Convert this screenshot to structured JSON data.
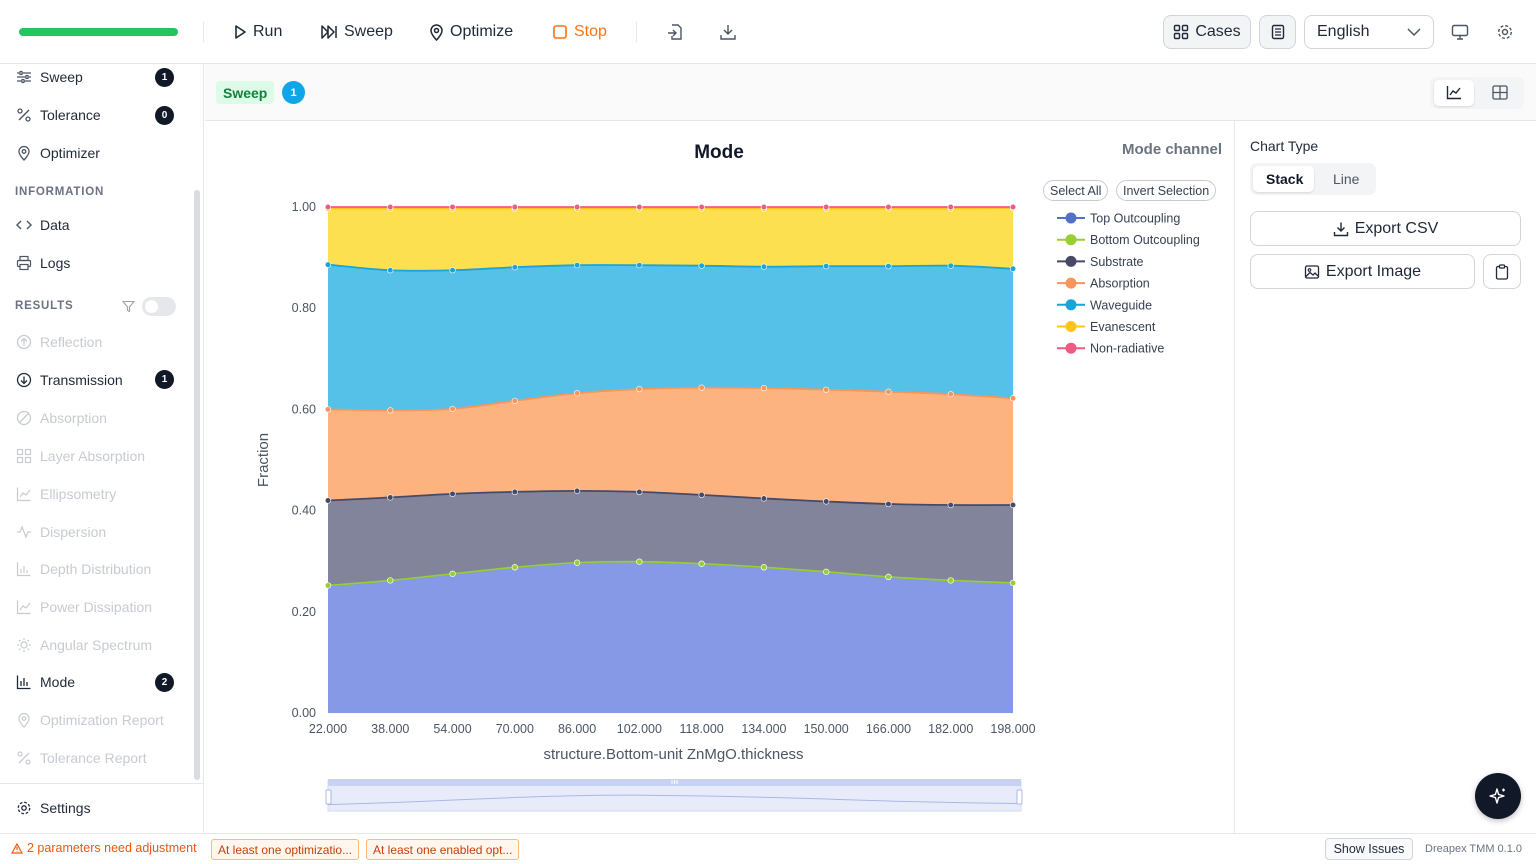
{
  "toolbar": {
    "progress": 1.0,
    "run_label": "Run",
    "sweep_label": "Sweep",
    "optimize_label": "Optimize",
    "stop_label": "Stop",
    "cases_label": "Cases",
    "language": "English"
  },
  "sidebar": {
    "top_items": [
      {
        "label": "Sweep",
        "badge": "1"
      },
      {
        "label": "Tolerance",
        "badge": "0"
      },
      {
        "label": "Optimizer"
      }
    ],
    "information_header": "INFORMATION",
    "information_items": [
      {
        "label": "Data"
      },
      {
        "label": "Logs"
      }
    ],
    "results_header": "RESULTS",
    "results_items": [
      {
        "label": "Reflection"
      },
      {
        "label": "Transmission",
        "badge": "1"
      },
      {
        "label": "Absorption"
      },
      {
        "label": "Layer Absorption"
      },
      {
        "label": "Ellipsometry"
      },
      {
        "label": "Dispersion"
      },
      {
        "label": "Depth Distribution"
      },
      {
        "label": "Power Dissipation"
      },
      {
        "label": "Angular Spectrum"
      },
      {
        "label": "Mode",
        "badge": "2"
      },
      {
        "label": "Optimization Report"
      },
      {
        "label": "Tolerance Report"
      }
    ],
    "settings_label": "Settings"
  },
  "main": {
    "tag": "Sweep",
    "count": "1",
    "channel_label": "Mode channel",
    "select_all": "Select All",
    "invert_selection": "Invert Selection"
  },
  "right_panel": {
    "chart_type_label": "Chart Type",
    "stack_label": "Stack",
    "line_label": "Line",
    "export_csv": "Export CSV",
    "export_image": "Export Image"
  },
  "status": {
    "warning": "2 parameters need adjustment",
    "tag1": "At least one optimizatio...",
    "tag2": "At least one enabled opt...",
    "show_issues": "Show Issues",
    "version": "Dreapex TMM 0.1.0"
  },
  "chart_data": {
    "type": "area",
    "stacked": true,
    "title": "Mode",
    "xlabel": "structure.Bottom-unit ZnMgO.thickness",
    "ylabel": "Fraction",
    "x": [
      22,
      38,
      54,
      70,
      86,
      102,
      118,
      134,
      150,
      166,
      182,
      198
    ],
    "x_tick_labels": [
      "22.000",
      "38.000",
      "54.000",
      "70.000",
      "86.000",
      "102.000",
      "118.000",
      "134.000",
      "150.000",
      "166.000",
      "182.000",
      "198.000"
    ],
    "ylim": [
      0,
      1
    ],
    "y_ticks": [
      0,
      0.2,
      0.4,
      0.6,
      0.8,
      1.0
    ],
    "y_tick_labels": [
      "0.00",
      "0.20",
      "0.40",
      "0.60",
      "0.80",
      "1.00"
    ],
    "legend_position": "top-right",
    "series": [
      {
        "name": "Top Outcoupling",
        "color": "#5470c6",
        "fill": "#8699e6",
        "values": [
          0.252,
          0.262,
          0.275,
          0.288,
          0.297,
          0.299,
          0.295,
          0.288,
          0.279,
          0.269,
          0.262,
          0.257
        ]
      },
      {
        "name": "Bottom Outcoupling",
        "color": "#9acd32",
        "fill": "#b5d86a",
        "values": [
          0,
          0,
          0,
          0,
          0,
          0,
          0,
          0,
          0,
          0,
          0,
          0
        ]
      },
      {
        "name": "Substrate",
        "color": "#464a66",
        "fill": "#82849c",
        "values": [
          0.168,
          0.164,
          0.158,
          0.149,
          0.142,
          0.138,
          0.136,
          0.136,
          0.139,
          0.144,
          0.149,
          0.154
        ]
      },
      {
        "name": "Absorption",
        "color": "#f7955a",
        "fill": "#fdb380",
        "values": [
          0.18,
          0.172,
          0.168,
          0.18,
          0.193,
          0.203,
          0.212,
          0.218,
          0.221,
          0.222,
          0.219,
          0.211
        ]
      },
      {
        "name": "Waveguide",
        "color": "#1ba4d8",
        "fill": "#55c0e8",
        "values": [
          0.286,
          0.277,
          0.274,
          0.264,
          0.253,
          0.245,
          0.241,
          0.24,
          0.244,
          0.248,
          0.254,
          0.256
        ]
      },
      {
        "name": "Evanescent",
        "color": "#fcc419",
        "fill": "#fde04f",
        "values": [
          0.111,
          0.122,
          0.122,
          0.116,
          0.112,
          0.112,
          0.113,
          0.115,
          0.114,
          0.114,
          0.113,
          0.12
        ]
      },
      {
        "name": "Non-radiative",
        "color": "#ef5b84",
        "fill": "#f58aa8",
        "values": [
          0.003,
          0.003,
          0.003,
          0.003,
          0.003,
          0.003,
          0.003,
          0.003,
          0.003,
          0.003,
          0.003,
          0.002
        ]
      }
    ]
  }
}
